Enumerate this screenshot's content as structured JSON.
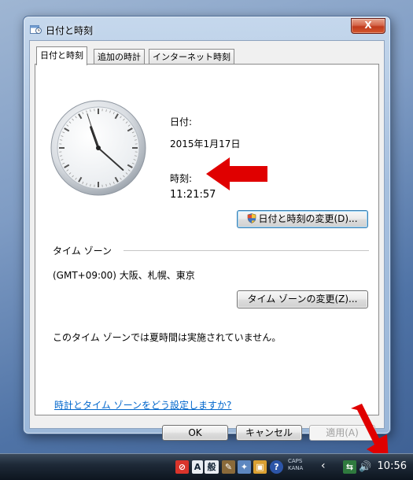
{
  "window": {
    "title": "日付と時刻",
    "close_label": "X"
  },
  "tabs": [
    {
      "label": "日付と時刻",
      "active": true
    },
    {
      "label": "追加の時計",
      "active": false
    },
    {
      "label": "インターネット時刻",
      "active": false
    }
  ],
  "panel": {
    "date_label": "日付:",
    "date_value": "2015年1月17日",
    "time_label": "時刻:",
    "time_value": "11:21:57",
    "change_datetime_button": "日付と時刻の変更(D)...",
    "timezone_section_label": "タイム ゾーン",
    "timezone_value": "(GMT+09:00) 大阪、札幌、東京",
    "change_timezone_button": "タイム ゾーンの変更(Z)...",
    "dst_message": "このタイム ゾーンでは夏時間は実施されていません。",
    "help_link": "時計とタイム ゾーンをどう設定しますか?"
  },
  "clock_face": {
    "hour": 11,
    "minute": 21,
    "second": 57
  },
  "footer": {
    "ok_button": "OK",
    "cancel_button": "キャンセル",
    "apply_button": "適用(A)"
  },
  "taskbar": {
    "ime_a": "A",
    "ime_kanji": "般",
    "caps_label": "CAPS",
    "kana_label": "KANA",
    "clock_time": "10:56"
  },
  "colors": {
    "arrow": "#e00000",
    "link": "#0066cc",
    "close_button": "#c8452a"
  }
}
